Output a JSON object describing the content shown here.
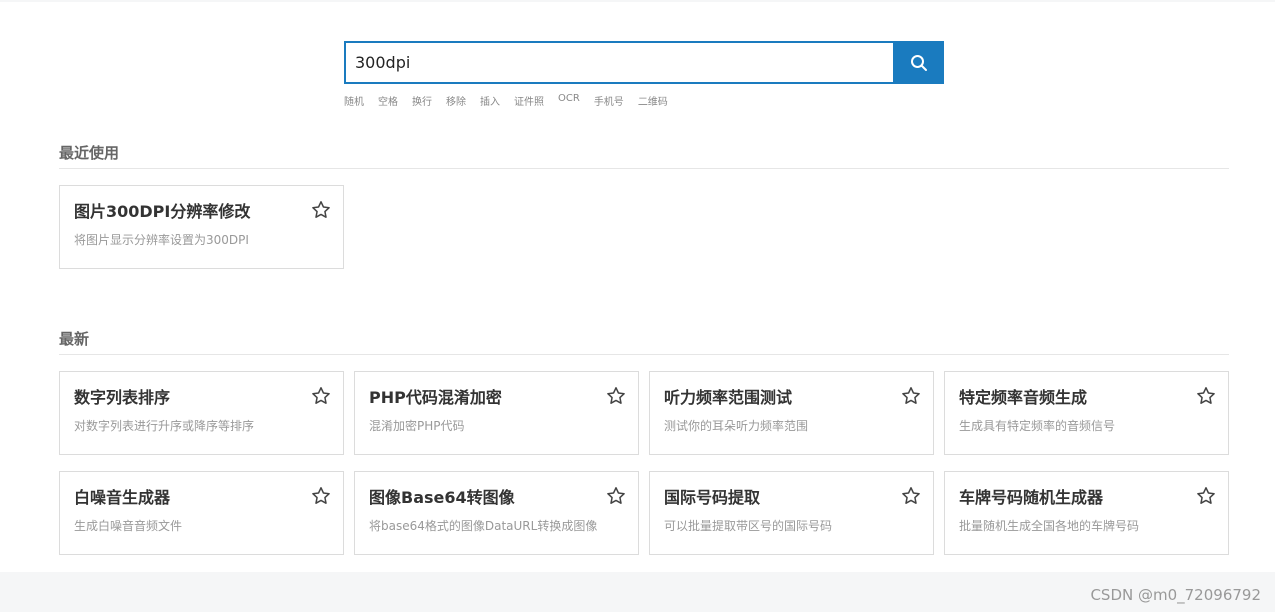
{
  "search": {
    "value": "300dpi",
    "button_icon": "search-icon",
    "button_color": "#1a7bbf"
  },
  "quick_links": [
    "随机",
    "空格",
    "换行",
    "移除",
    "插入",
    "证件照",
    "OCR",
    "手机号",
    "二维码"
  ],
  "recent": {
    "title": "最近使用",
    "cards": [
      {
        "title": "图片300DPI分辨率修改",
        "desc": "将图片显示分辨率设置为300DPI",
        "icon": "star-icon"
      }
    ]
  },
  "latest": {
    "title": "最新",
    "cards": [
      {
        "title": "数字列表排序",
        "desc": "对数字列表进行升序或降序等排序",
        "icon": "star-icon"
      },
      {
        "title": "PHP代码混淆加密",
        "desc": "混淆加密PHP代码",
        "icon": "star-icon"
      },
      {
        "title": "听力频率范围测试",
        "desc": "测试你的耳朵听力频率范围",
        "icon": "star-icon"
      },
      {
        "title": "特定频率音频生成",
        "desc": "生成具有特定频率的音频信号",
        "icon": "star-icon"
      },
      {
        "title": "白噪音生成器",
        "desc": "生成白噪音音频文件",
        "icon": "star-icon"
      },
      {
        "title": "图像Base64转图像",
        "desc": "将base64格式的图像DataURL转换成图像",
        "icon": "star-icon"
      },
      {
        "title": "国际号码提取",
        "desc": "可以批量提取带区号的国际号码",
        "icon": "star-icon"
      },
      {
        "title": "车牌号码随机生成器",
        "desc": "批量随机生成全国各地的车牌号码",
        "icon": "star-icon"
      }
    ]
  },
  "watermark": "CSDN @m0_72096792"
}
